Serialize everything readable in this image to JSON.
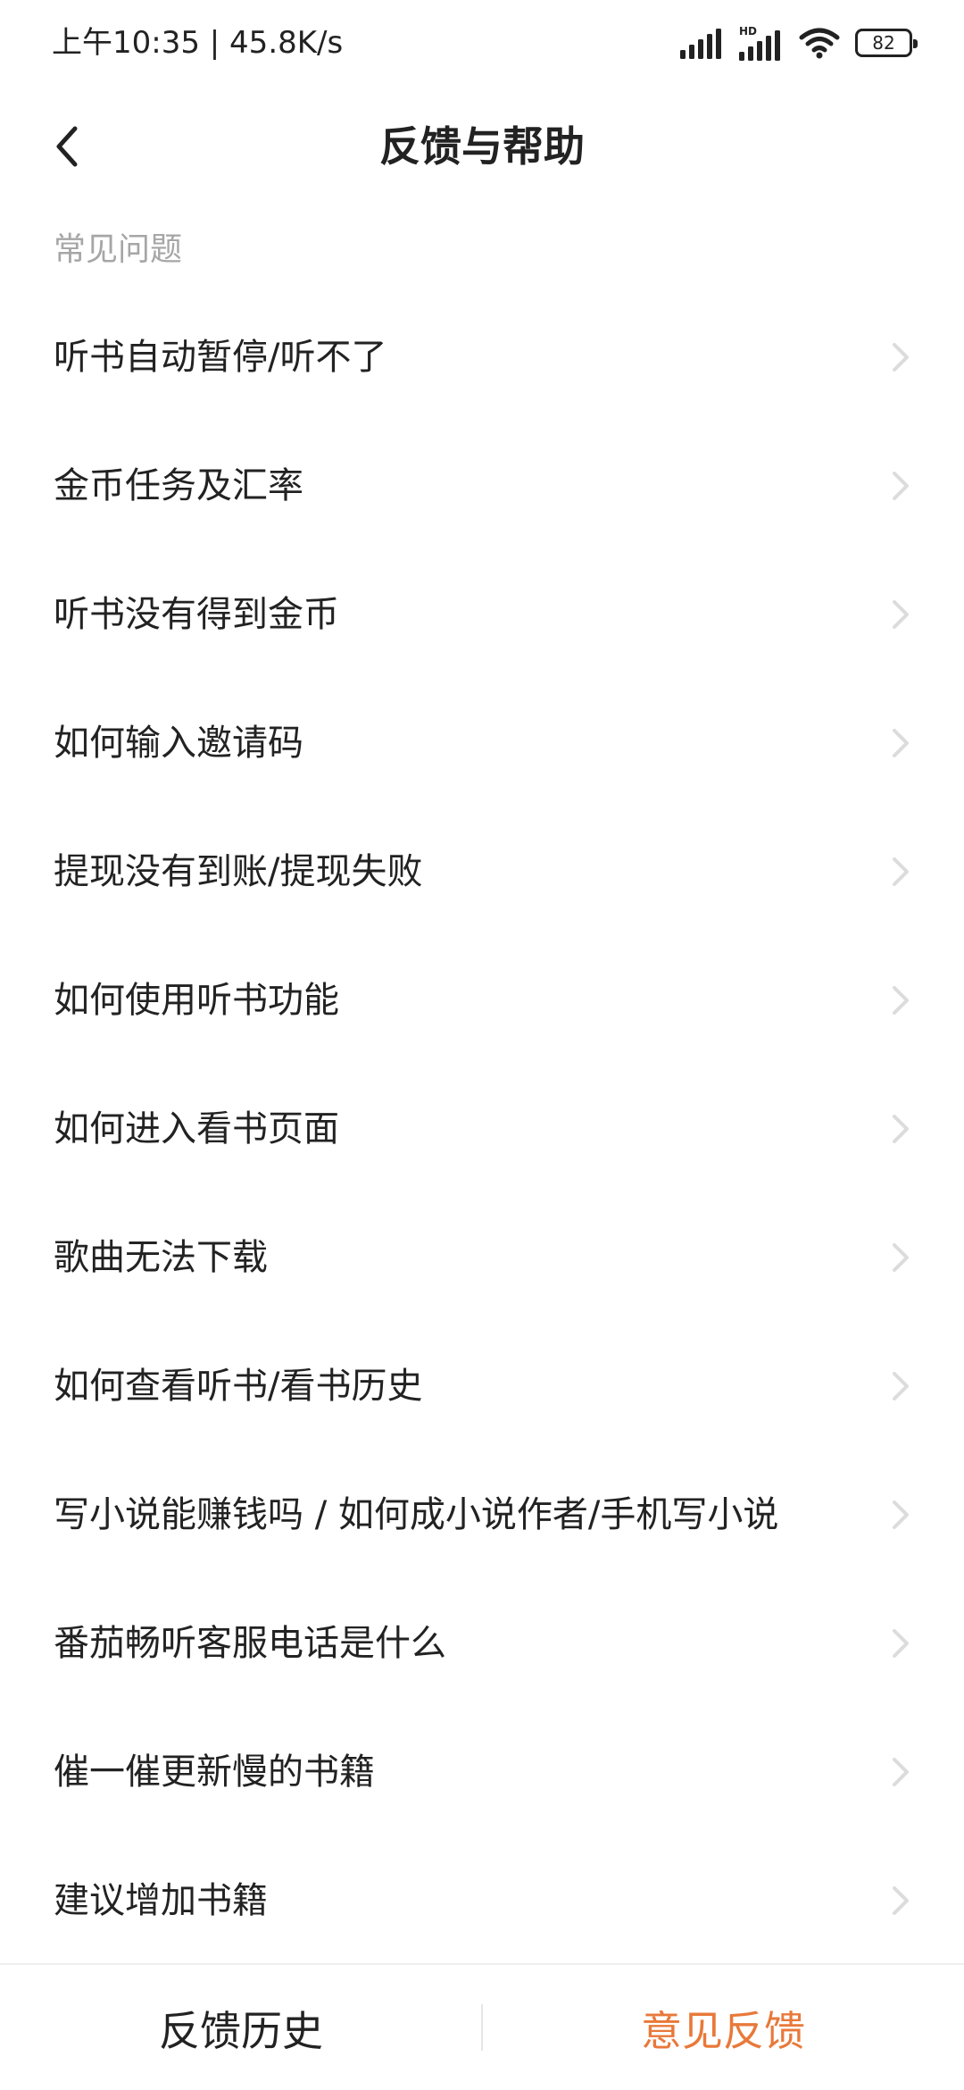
{
  "status_bar": {
    "time_speed": "上午10:35 | 45.8K/s",
    "battery_level": "82",
    "hd_label": "HD",
    "icons": [
      "signal-icon",
      "hd-signal-icon",
      "wifi-icon",
      "battery-icon"
    ]
  },
  "nav": {
    "title": "反馈与帮助",
    "back_icon": "back-arrow-icon"
  },
  "faq": {
    "section_title": "常见问题",
    "items": [
      {
        "label": "听书自动暂停/听不了"
      },
      {
        "label": "金币任务及汇率"
      },
      {
        "label": "听书没有得到金币"
      },
      {
        "label": "如何输入邀请码"
      },
      {
        "label": "提现没有到账/提现失败"
      },
      {
        "label": "如何使用听书功能"
      },
      {
        "label": "如何进入看书页面"
      },
      {
        "label": "歌曲无法下载"
      },
      {
        "label": "如何查看听书/看书历史"
      },
      {
        "label": "写小说能赚钱吗 / 如何成小说作者/手机写小说"
      },
      {
        "label": "番茄畅听客服电话是什么"
      },
      {
        "label": "催一催更新慢的书籍"
      },
      {
        "label": "建议增加书籍"
      }
    ]
  },
  "bottom_bar": {
    "history_label": "反馈历史",
    "feedback_label": "意见反馈",
    "accent_color": "#e8793a"
  }
}
